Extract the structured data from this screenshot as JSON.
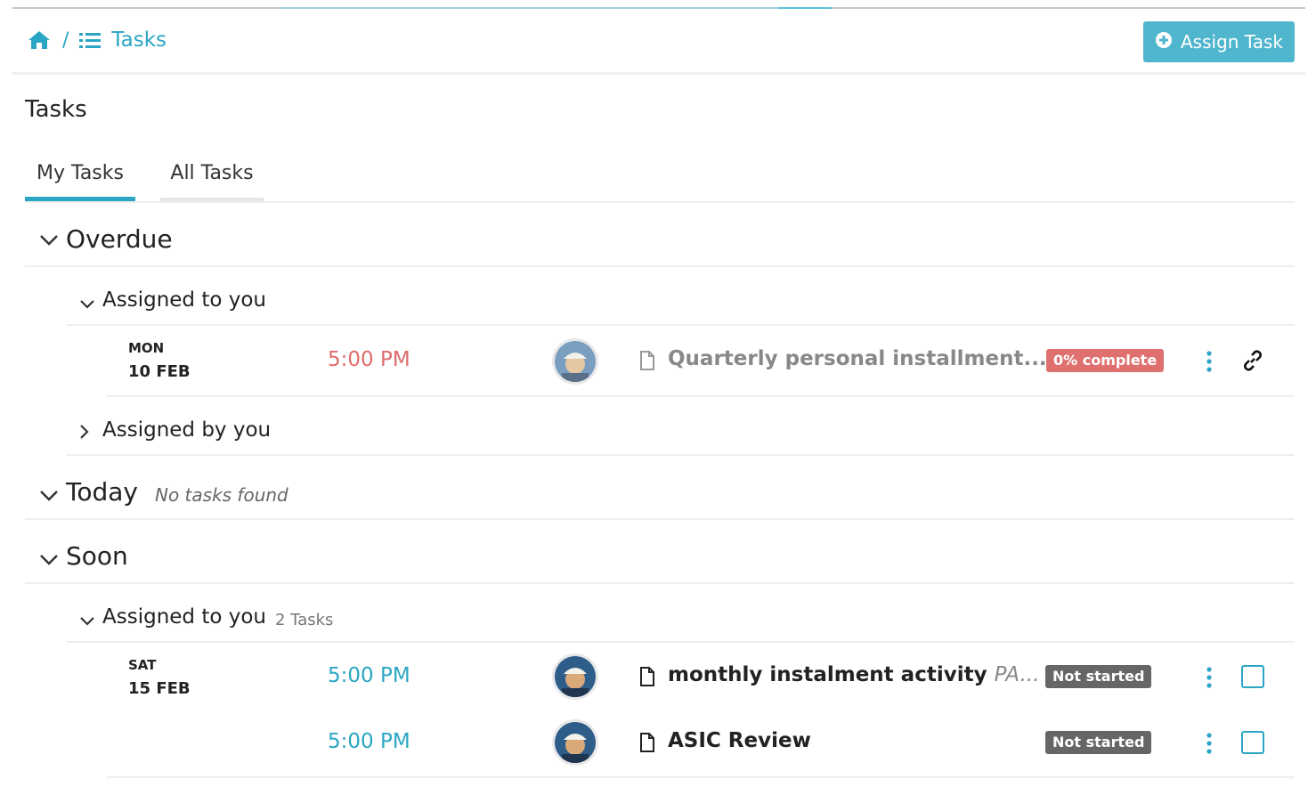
{
  "breadcrumb": {
    "separator": "/",
    "current": "Tasks"
  },
  "assign_button": {
    "label": "Assign Task"
  },
  "page_title": "Tasks",
  "tabs": [
    {
      "label": "My Tasks",
      "active": true
    },
    {
      "label": "All Tasks",
      "active": false
    }
  ],
  "sections": {
    "overdue": {
      "title": "Overdue",
      "assigned_to_you": {
        "label": "Assigned to you",
        "tasks": [
          {
            "day": "MON",
            "date": "10 FEB",
            "time": "5:00 PM",
            "name": "Quarterly personal installment...",
            "status": "0% complete"
          }
        ]
      },
      "assigned_by_you": {
        "label": "Assigned by you"
      }
    },
    "today": {
      "title": "Today",
      "note": "No tasks found"
    },
    "soon": {
      "title": "Soon",
      "assigned_to_you": {
        "label": "Assigned to you",
        "count": "2 Tasks",
        "tasks": [
          {
            "day": "SAT",
            "date": "15 FEB",
            "time": "5:00 PM",
            "name": "monthly instalment activity",
            "extra": "PA...",
            "status": "Not started"
          },
          {
            "time": "5:00 PM",
            "name": "ASIC Review",
            "status": "Not started"
          }
        ]
      }
    }
  },
  "colors": {
    "accent": "#2aa6c4",
    "button": "#50b6ce",
    "overdue": "#e06b6b",
    "not_started": "#666666"
  }
}
